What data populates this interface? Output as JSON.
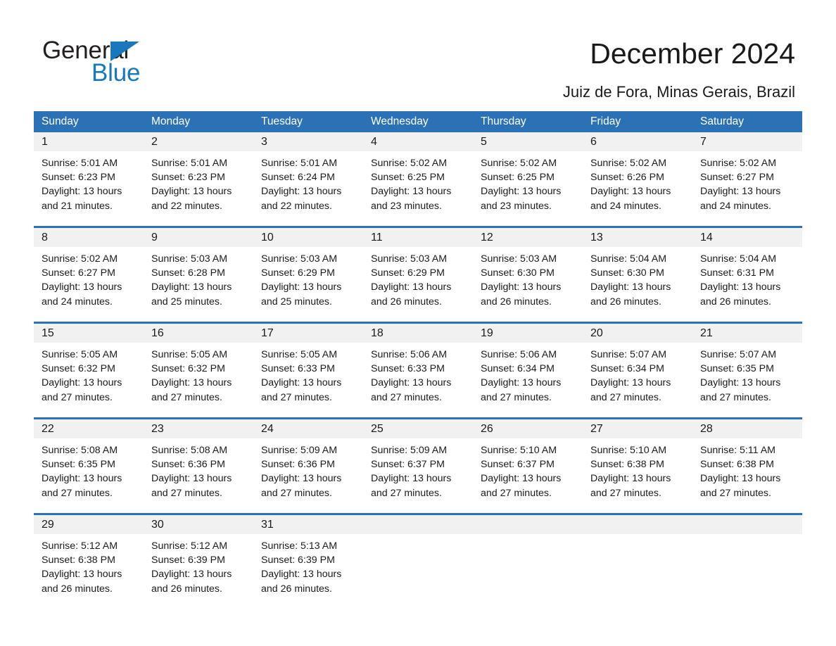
{
  "brand": {
    "name_part1": "General",
    "name_part2": "Blue",
    "accent_color": "#1878be",
    "triangle_icon": "triangle-icon"
  },
  "header": {
    "title": "December 2024",
    "subtitle": "Juiz de Fora, Minas Gerais, Brazil"
  },
  "calendar": {
    "header_bg_color": "#2a72b5",
    "daynum_bg_color": "#f1f1f1",
    "weekdays": [
      "Sunday",
      "Monday",
      "Tuesday",
      "Wednesday",
      "Thursday",
      "Friday",
      "Saturday"
    ],
    "weeks": [
      [
        {
          "day": "1",
          "sunrise": "Sunrise: 5:01 AM",
          "sunset": "Sunset: 6:23 PM",
          "daylight_line1": "Daylight: 13 hours",
          "daylight_line2": "and 21 minutes."
        },
        {
          "day": "2",
          "sunrise": "Sunrise: 5:01 AM",
          "sunset": "Sunset: 6:23 PM",
          "daylight_line1": "Daylight: 13 hours",
          "daylight_line2": "and 22 minutes."
        },
        {
          "day": "3",
          "sunrise": "Sunrise: 5:01 AM",
          "sunset": "Sunset: 6:24 PM",
          "daylight_line1": "Daylight: 13 hours",
          "daylight_line2": "and 22 minutes."
        },
        {
          "day": "4",
          "sunrise": "Sunrise: 5:02 AM",
          "sunset": "Sunset: 6:25 PM",
          "daylight_line1": "Daylight: 13 hours",
          "daylight_line2": "and 23 minutes."
        },
        {
          "day": "5",
          "sunrise": "Sunrise: 5:02 AM",
          "sunset": "Sunset: 6:25 PM",
          "daylight_line1": "Daylight: 13 hours",
          "daylight_line2": "and 23 minutes."
        },
        {
          "day": "6",
          "sunrise": "Sunrise: 5:02 AM",
          "sunset": "Sunset: 6:26 PM",
          "daylight_line1": "Daylight: 13 hours",
          "daylight_line2": "and 24 minutes."
        },
        {
          "day": "7",
          "sunrise": "Sunrise: 5:02 AM",
          "sunset": "Sunset: 6:27 PM",
          "daylight_line1": "Daylight: 13 hours",
          "daylight_line2": "and 24 minutes."
        }
      ],
      [
        {
          "day": "8",
          "sunrise": "Sunrise: 5:02 AM",
          "sunset": "Sunset: 6:27 PM",
          "daylight_line1": "Daylight: 13 hours",
          "daylight_line2": "and 24 minutes."
        },
        {
          "day": "9",
          "sunrise": "Sunrise: 5:03 AM",
          "sunset": "Sunset: 6:28 PM",
          "daylight_line1": "Daylight: 13 hours",
          "daylight_line2": "and 25 minutes."
        },
        {
          "day": "10",
          "sunrise": "Sunrise: 5:03 AM",
          "sunset": "Sunset: 6:29 PM",
          "daylight_line1": "Daylight: 13 hours",
          "daylight_line2": "and 25 minutes."
        },
        {
          "day": "11",
          "sunrise": "Sunrise: 5:03 AM",
          "sunset": "Sunset: 6:29 PM",
          "daylight_line1": "Daylight: 13 hours",
          "daylight_line2": "and 26 minutes."
        },
        {
          "day": "12",
          "sunrise": "Sunrise: 5:03 AM",
          "sunset": "Sunset: 6:30 PM",
          "daylight_line1": "Daylight: 13 hours",
          "daylight_line2": "and 26 minutes."
        },
        {
          "day": "13",
          "sunrise": "Sunrise: 5:04 AM",
          "sunset": "Sunset: 6:30 PM",
          "daylight_line1": "Daylight: 13 hours",
          "daylight_line2": "and 26 minutes."
        },
        {
          "day": "14",
          "sunrise": "Sunrise: 5:04 AM",
          "sunset": "Sunset: 6:31 PM",
          "daylight_line1": "Daylight: 13 hours",
          "daylight_line2": "and 26 minutes."
        }
      ],
      [
        {
          "day": "15",
          "sunrise": "Sunrise: 5:05 AM",
          "sunset": "Sunset: 6:32 PM",
          "daylight_line1": "Daylight: 13 hours",
          "daylight_line2": "and 27 minutes."
        },
        {
          "day": "16",
          "sunrise": "Sunrise: 5:05 AM",
          "sunset": "Sunset: 6:32 PM",
          "daylight_line1": "Daylight: 13 hours",
          "daylight_line2": "and 27 minutes."
        },
        {
          "day": "17",
          "sunrise": "Sunrise: 5:05 AM",
          "sunset": "Sunset: 6:33 PM",
          "daylight_line1": "Daylight: 13 hours",
          "daylight_line2": "and 27 minutes."
        },
        {
          "day": "18",
          "sunrise": "Sunrise: 5:06 AM",
          "sunset": "Sunset: 6:33 PM",
          "daylight_line1": "Daylight: 13 hours",
          "daylight_line2": "and 27 minutes."
        },
        {
          "day": "19",
          "sunrise": "Sunrise: 5:06 AM",
          "sunset": "Sunset: 6:34 PM",
          "daylight_line1": "Daylight: 13 hours",
          "daylight_line2": "and 27 minutes."
        },
        {
          "day": "20",
          "sunrise": "Sunrise: 5:07 AM",
          "sunset": "Sunset: 6:34 PM",
          "daylight_line1": "Daylight: 13 hours",
          "daylight_line2": "and 27 minutes."
        },
        {
          "day": "21",
          "sunrise": "Sunrise: 5:07 AM",
          "sunset": "Sunset: 6:35 PM",
          "daylight_line1": "Daylight: 13 hours",
          "daylight_line2": "and 27 minutes."
        }
      ],
      [
        {
          "day": "22",
          "sunrise": "Sunrise: 5:08 AM",
          "sunset": "Sunset: 6:35 PM",
          "daylight_line1": "Daylight: 13 hours",
          "daylight_line2": "and 27 minutes."
        },
        {
          "day": "23",
          "sunrise": "Sunrise: 5:08 AM",
          "sunset": "Sunset: 6:36 PM",
          "daylight_line1": "Daylight: 13 hours",
          "daylight_line2": "and 27 minutes."
        },
        {
          "day": "24",
          "sunrise": "Sunrise: 5:09 AM",
          "sunset": "Sunset: 6:36 PM",
          "daylight_line1": "Daylight: 13 hours",
          "daylight_line2": "and 27 minutes."
        },
        {
          "day": "25",
          "sunrise": "Sunrise: 5:09 AM",
          "sunset": "Sunset: 6:37 PM",
          "daylight_line1": "Daylight: 13 hours",
          "daylight_line2": "and 27 minutes."
        },
        {
          "day": "26",
          "sunrise": "Sunrise: 5:10 AM",
          "sunset": "Sunset: 6:37 PM",
          "daylight_line1": "Daylight: 13 hours",
          "daylight_line2": "and 27 minutes."
        },
        {
          "day": "27",
          "sunrise": "Sunrise: 5:10 AM",
          "sunset": "Sunset: 6:38 PM",
          "daylight_line1": "Daylight: 13 hours",
          "daylight_line2": "and 27 minutes."
        },
        {
          "day": "28",
          "sunrise": "Sunrise: 5:11 AM",
          "sunset": "Sunset: 6:38 PM",
          "daylight_line1": "Daylight: 13 hours",
          "daylight_line2": "and 27 minutes."
        }
      ],
      [
        {
          "day": "29",
          "sunrise": "Sunrise: 5:12 AM",
          "sunset": "Sunset: 6:38 PM",
          "daylight_line1": "Daylight: 13 hours",
          "daylight_line2": "and 26 minutes."
        },
        {
          "day": "30",
          "sunrise": "Sunrise: 5:12 AM",
          "sunset": "Sunset: 6:39 PM",
          "daylight_line1": "Daylight: 13 hours",
          "daylight_line2": "and 26 minutes."
        },
        {
          "day": "31",
          "sunrise": "Sunrise: 5:13 AM",
          "sunset": "Sunset: 6:39 PM",
          "daylight_line1": "Daylight: 13 hours",
          "daylight_line2": "and 26 minutes."
        },
        {
          "day": "",
          "sunrise": "",
          "sunset": "",
          "daylight_line1": "",
          "daylight_line2": ""
        },
        {
          "day": "",
          "sunrise": "",
          "sunset": "",
          "daylight_line1": "",
          "daylight_line2": ""
        },
        {
          "day": "",
          "sunrise": "",
          "sunset": "",
          "daylight_line1": "",
          "daylight_line2": ""
        },
        {
          "day": "",
          "sunrise": "",
          "sunset": "",
          "daylight_line1": "",
          "daylight_line2": ""
        }
      ]
    ]
  }
}
